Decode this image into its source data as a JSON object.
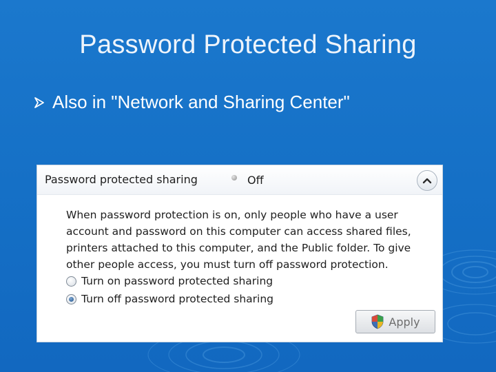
{
  "slide": {
    "title": "Password Protected Sharing",
    "bullet": "Also in \"Network and Sharing Center\""
  },
  "panel": {
    "title": "Password protected sharing",
    "status_value": "Off",
    "description_lines": [
      "When password protection is on, only people who have a user",
      "account and password on this computer can access shared files,",
      "printers attached to this computer, and the Public folder. To give",
      "other people access, you must turn off password protection."
    ],
    "options": [
      {
        "label": "Turn on password protected sharing",
        "selected": false
      },
      {
        "label": "Turn off password protected sharing",
        "selected": true
      }
    ],
    "apply_label": "Apply",
    "collapse_icon": "chevron-up-icon",
    "apply_icon": "shield-icon"
  },
  "colors": {
    "background": "#1673c8",
    "title_text": "#eef4fb",
    "panel_bg": "#ffffff"
  }
}
